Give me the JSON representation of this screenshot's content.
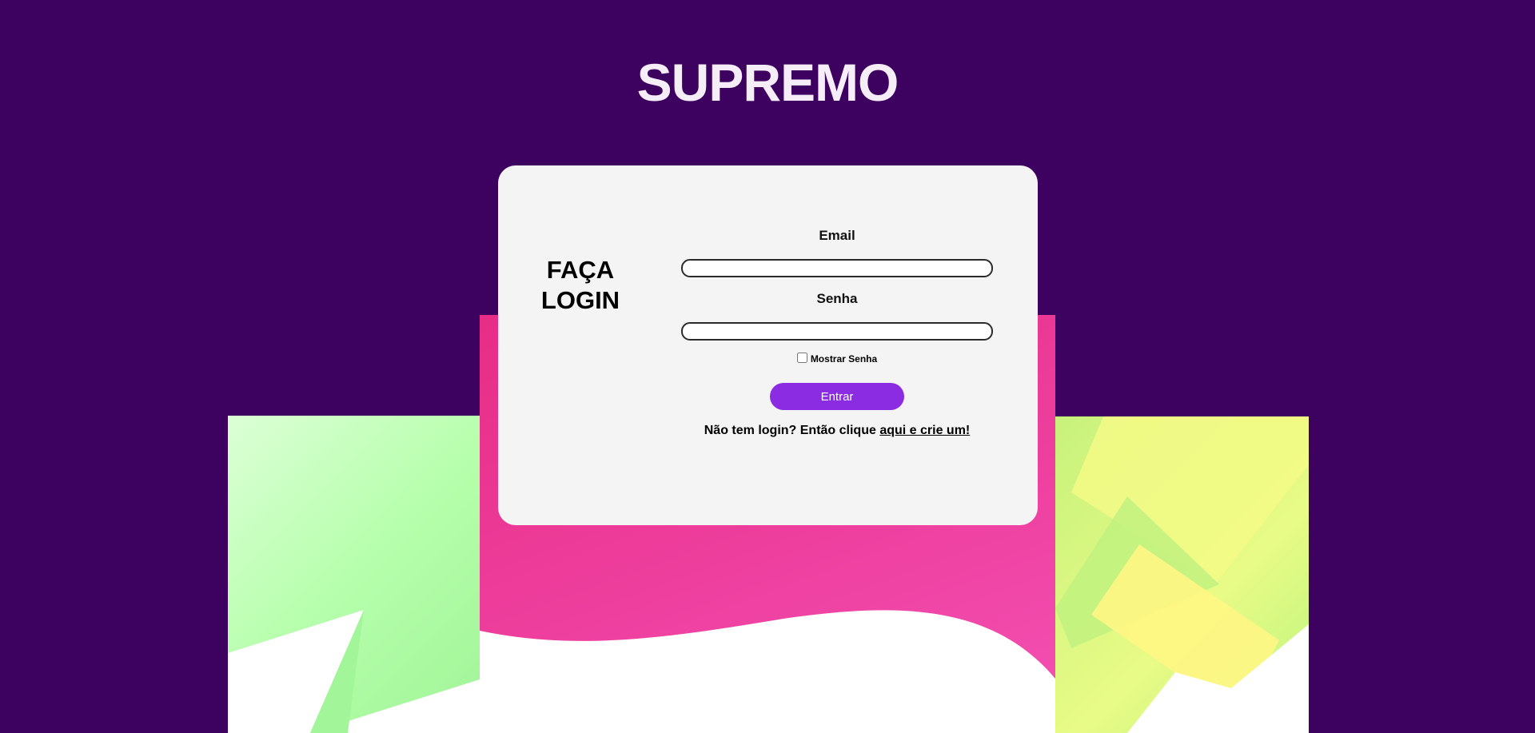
{
  "brand": {
    "title": "SUPREMO"
  },
  "login": {
    "title_line1": "FAÇA",
    "title_line2": "LOGIN",
    "email_label": "Email",
    "email_value": "",
    "password_label": "Senha",
    "password_value": "",
    "show_password_label": "Mostrar Senha",
    "show_password_checked": false,
    "submit_label": "Entrar",
    "signup_prompt": "Não tem login? Então clique ",
    "signup_link": "aqui e crie um!"
  },
  "colors": {
    "background": "#3d0260",
    "card": "#f4f4f4",
    "button": "#8b2be2",
    "brand_text": "#f5eef8",
    "pink_panel": "#ee3f9e",
    "green_panel": "#b6ffac",
    "yellow_panel": "#e8fb86"
  }
}
